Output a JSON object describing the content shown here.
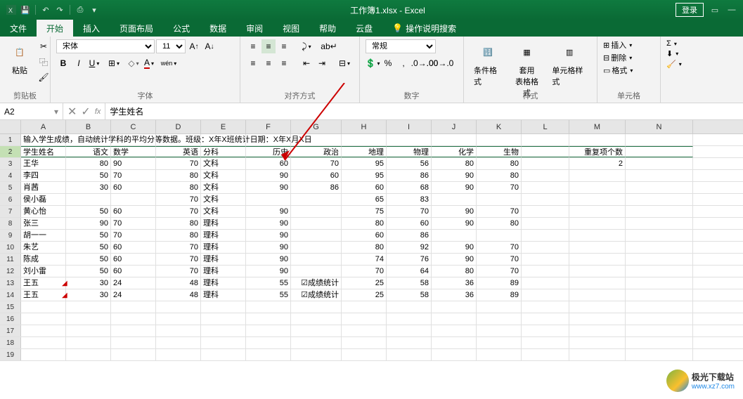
{
  "titlebar": {
    "app_title": "工作簿1.xlsx - Excel",
    "login": "登录"
  },
  "tabs": {
    "file": "文件",
    "home": "开始",
    "insert": "插入",
    "layout": "页面布局",
    "formulas": "公式",
    "data": "数据",
    "review": "审阅",
    "view": "视图",
    "help": "帮助",
    "cloud": "云盘",
    "tell": "操作说明搜索"
  },
  "ribbon": {
    "clipboard": {
      "paste": "粘贴",
      "label": "剪贴板"
    },
    "font": {
      "family": "宋体",
      "size": "11",
      "label": "字体",
      "wen": "wén"
    },
    "align": {
      "label": "对齐方式"
    },
    "number": {
      "preset": "常规",
      "label": "数字"
    },
    "styles": {
      "cond": "条件格式",
      "table": "套用\n表格格式",
      "cell": "单元格样式",
      "label": "样式"
    },
    "cells": {
      "insert": "插入",
      "delete": "删除",
      "format": "格式",
      "label": "单元格"
    }
  },
  "formula_bar": {
    "name": "A2",
    "fx": "fx",
    "value": "学生姓名"
  },
  "columns": [
    "A",
    "B",
    "C",
    "D",
    "E",
    "F",
    "G",
    "H",
    "I",
    "J",
    "K",
    "L",
    "M",
    "N"
  ],
  "row1_text": "输入学生成绩，自动统计学科的平均分等数据。班级：X年X班统计日期：X年X月X日",
  "headers": {
    "A": "学生姓名",
    "B": "语文",
    "C": "数学",
    "D": "英语",
    "E": "分科",
    "F": "历史",
    "G": "政治",
    "H": "地理",
    "I": "物理",
    "J": "化学",
    "K": "生物",
    "L": "",
    "M": "重复项个数"
  },
  "data": [
    {
      "r": 3,
      "A": "王华",
      "B": "80",
      "C": "90",
      "D": "70",
      "E": "文科",
      "F": "60",
      "G": "70",
      "H": "95",
      "I": "56",
      "J": "80",
      "K": "80",
      "M": "2"
    },
    {
      "r": 4,
      "A": "李四",
      "B": "50",
      "C": "70",
      "D": "80",
      "E": "文科",
      "F": "90",
      "G": "60",
      "H": "95",
      "I": "86",
      "J": "90",
      "K": "80"
    },
    {
      "r": 5,
      "A": "肖茜",
      "B": "30",
      "C": "60",
      "D": "80",
      "E": "文科",
      "F": "90",
      "G": "86",
      "H": "60",
      "I": "68",
      "J": "90",
      "K": "70"
    },
    {
      "r": 6,
      "A": "侯小磊",
      "B": "",
      "C": "",
      "D": "70",
      "E": "文科",
      "F": "",
      "G": "",
      "H": "65",
      "I": "83",
      "J": "",
      "K": ""
    },
    {
      "r": 7,
      "A": "黄心怡",
      "B": "50",
      "C": "60",
      "D": "70",
      "E": "文科",
      "F": "90",
      "G": "",
      "H": "75",
      "I": "70",
      "J": "90",
      "K": "70"
    },
    {
      "r": 8,
      "A": "张三",
      "B": "90",
      "C": "70",
      "D": "80",
      "E": "理科",
      "F": "90",
      "G": "",
      "H": "80",
      "I": "60",
      "J": "90",
      "K": "80"
    },
    {
      "r": 9,
      "A": "胡一一",
      "B": "50",
      "C": "70",
      "D": "80",
      "E": "理科",
      "F": "90",
      "G": "",
      "H": "60",
      "I": "86",
      "J": "",
      "K": ""
    },
    {
      "r": 10,
      "A": "朱艺",
      "B": "50",
      "C": "60",
      "D": "70",
      "E": "理科",
      "F": "90",
      "G": "",
      "H": "80",
      "I": "92",
      "J": "90",
      "K": "70"
    },
    {
      "r": 11,
      "A": "陈成",
      "B": "50",
      "C": "60",
      "D": "70",
      "E": "理科",
      "F": "90",
      "G": "",
      "H": "74",
      "I": "76",
      "J": "90",
      "K": "70"
    },
    {
      "r": 12,
      "A": "刘小雷",
      "B": "50",
      "C": "60",
      "D": "70",
      "E": "理科",
      "F": "90",
      "G": "",
      "H": "70",
      "I": "64",
      "J": "80",
      "K": "70"
    },
    {
      "r": 13,
      "A": "王五",
      "B": "30",
      "C": "24",
      "D": "48",
      "E": "理科",
      "F": "55",
      "G": "☑成绩统计",
      "H": "25",
      "I": "58",
      "J": "36",
      "K": "89"
    },
    {
      "r": 14,
      "A": "王五",
      "B": "30",
      "C": "24",
      "D": "48",
      "E": "理科",
      "F": "55",
      "G": "☑成绩统计",
      "H": "25",
      "I": "58",
      "J": "36",
      "K": "89"
    }
  ],
  "empty_rows": [
    15,
    16,
    17,
    18,
    19
  ],
  "watermark": {
    "name": "极光下载站",
    "url": "www.xz7.com"
  }
}
